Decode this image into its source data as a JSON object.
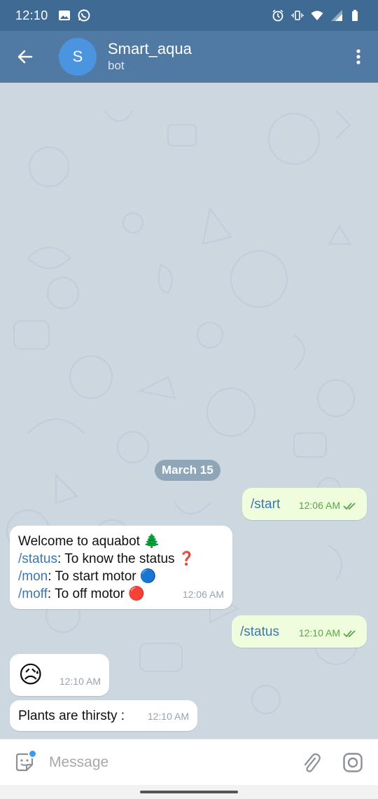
{
  "status_bar": {
    "time": "12:10"
  },
  "header": {
    "avatar_letter": "S",
    "title": "Smart_aqua",
    "subtitle": "bot"
  },
  "date_divider": "March 15",
  "messages": {
    "m1": {
      "text": "/start",
      "time": "12:06 AM"
    },
    "m2": {
      "line1": "Welcome to aquabot 🌲",
      "line2_cmd": "/status",
      "line2_rest": ": To know the status ❓",
      "line3_cmd": "/mon",
      "line3_rest": ": To start motor 🔵",
      "line4_cmd": "/moff",
      "line4_rest": ": To off motor 🔴",
      "time": "12:06 AM"
    },
    "m3": {
      "text": "/status",
      "time": "12:10 AM"
    },
    "m4": {
      "text": "😥",
      "time": "12:10 AM"
    },
    "m5": {
      "text": "Plants are thirsty :",
      "time": "12:10 AM"
    }
  },
  "input": {
    "placeholder": "Message"
  },
  "colors": {
    "header_bg": "#5079a3",
    "status_bg": "#3f6a93",
    "outgoing_bubble": "#effddc",
    "incoming_bubble": "#ffffff",
    "link": "#3a78b5",
    "read_check": "#5aa44c"
  },
  "icons": [
    "image-icon",
    "whatsapp-icon",
    "alarm-icon",
    "vibrate-icon",
    "wifi-icon",
    "signal-icon",
    "battery-icon",
    "back-arrow-icon",
    "more-vert-icon",
    "sticker-icon",
    "attach-icon",
    "camera-icon",
    "double-check-icon"
  ]
}
